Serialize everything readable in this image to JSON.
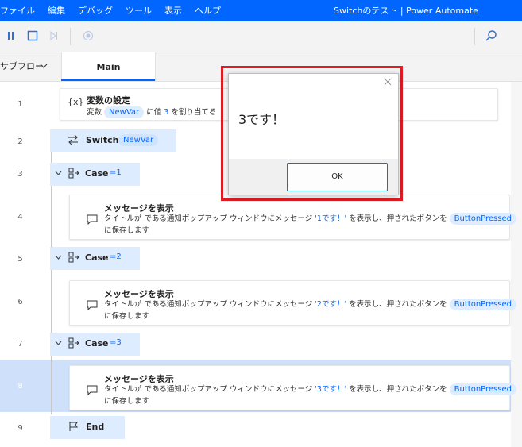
{
  "menu": [
    "ファイル",
    "編集",
    "デバッグ",
    "ツール",
    "表示",
    "ヘルプ"
  ],
  "app_title": "Switchのテスト | Power Automate",
  "tabs": {
    "subflow": "サブフロー",
    "main": "Main"
  },
  "line_numbers": [
    "1",
    "2",
    "3",
    "4",
    "5",
    "6",
    "7",
    "8",
    "9"
  ],
  "steps": {
    "s1": {
      "title": "変数の設定",
      "p1": "変数",
      "var": "NewVar",
      "p2": "に値",
      "value": "3",
      "p3": "を割り当てる"
    },
    "s2": {
      "title": "Switch",
      "var": "NewVar"
    },
    "s3": {
      "title": "Case",
      "cond": "=1"
    },
    "s4": {
      "title": "メッセージを表示",
      "p1": "タイトルが  である通知ポップアップ ウィンドウにメッセージ",
      "msg": "'1です！'",
      "p2": "を表示し、押されたボタンを",
      "var": "ButtonPressed",
      "p3": "に保存します"
    },
    "s5": {
      "title": "Case",
      "cond": "=2"
    },
    "s6": {
      "title": "メッセージを表示",
      "p1": "タイトルが  である通知ポップアップ ウィンドウにメッセージ",
      "msg": "'2です！'",
      "p2": "を表示し、押されたボタンを",
      "var": "ButtonPressed",
      "p3": "に保存します"
    },
    "s7": {
      "title": "Case",
      "cond": "=3"
    },
    "s8": {
      "title": "メッセージを表示",
      "p1": "タイトルが  である通知ポップアップ ウィンドウにメッセージ",
      "msg": "'3です！'",
      "p2": "を表示し、押されたボタンを",
      "var": "ButtonPressed",
      "p3": "に保存します"
    },
    "s9": {
      "title": "End"
    }
  },
  "dialog": {
    "message": "3です！",
    "ok": "OK"
  },
  "icons": {
    "pause": "pause-icon",
    "stop": "stop-icon",
    "step": "step-icon",
    "record": "record-icon",
    "search": "search-icon"
  },
  "colors": {
    "accent": "#0066ff",
    "highlight": "#cfe0fb",
    "outline": "#e31b23"
  }
}
